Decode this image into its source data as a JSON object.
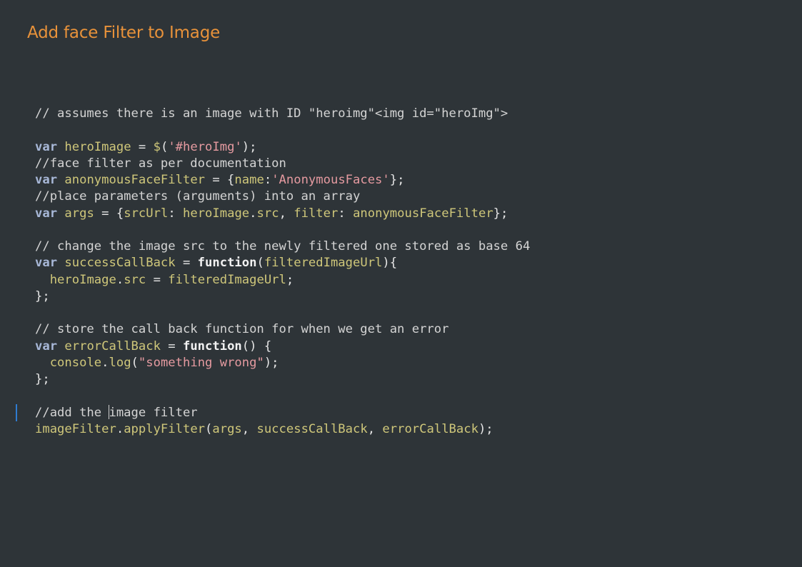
{
  "page": {
    "title": "Add face Filter to Image"
  },
  "theme": {
    "background": "#2e3438",
    "title_color": "#e8923a",
    "keyword_color": "#a8b8d8",
    "identifier_color": "#cfc77a",
    "string_color": "#e59aa0",
    "active_line_marker": "#2f7bd0"
  },
  "editor": {
    "cursor_line": 19,
    "lines": [
      [
        {
          "t": "comment",
          "v": "// assumes there is an image with ID \"heroimg\"<img id=\"heroImg\">"
        }
      ],
      [],
      [
        {
          "t": "keyword",
          "v": "var"
        },
        {
          "t": "plain",
          "v": " "
        },
        {
          "t": "ident",
          "v": "heroImage"
        },
        {
          "t": "plain",
          "v": " = "
        },
        {
          "t": "ident",
          "v": "$"
        },
        {
          "t": "plain",
          "v": "("
        },
        {
          "t": "string",
          "v": "'#heroImg'"
        },
        {
          "t": "plain",
          "v": ");"
        }
      ],
      [
        {
          "t": "comment",
          "v": "//face filter as per documentation"
        }
      ],
      [
        {
          "t": "keyword",
          "v": "var"
        },
        {
          "t": "plain",
          "v": " "
        },
        {
          "t": "ident",
          "v": "anonymousFaceFilter"
        },
        {
          "t": "plain",
          "v": " = {"
        },
        {
          "t": "ident",
          "v": "name"
        },
        {
          "t": "plain",
          "v": ":"
        },
        {
          "t": "string",
          "v": "'AnonymousFaces'"
        },
        {
          "t": "plain",
          "v": "};"
        }
      ],
      [
        {
          "t": "comment",
          "v": "//place parameters (arguments) into an array"
        }
      ],
      [
        {
          "t": "keyword",
          "v": "var"
        },
        {
          "t": "plain",
          "v": " "
        },
        {
          "t": "ident",
          "v": "args"
        },
        {
          "t": "plain",
          "v": " = {"
        },
        {
          "t": "ident",
          "v": "srcUrl"
        },
        {
          "t": "plain",
          "v": ": "
        },
        {
          "t": "ident",
          "v": "heroImage"
        },
        {
          "t": "plain",
          "v": "."
        },
        {
          "t": "ident",
          "v": "src"
        },
        {
          "t": "plain",
          "v": ", "
        },
        {
          "t": "ident",
          "v": "filter"
        },
        {
          "t": "plain",
          "v": ": "
        },
        {
          "t": "ident",
          "v": "anonymousFaceFilter"
        },
        {
          "t": "plain",
          "v": "};"
        }
      ],
      [],
      [
        {
          "t": "comment",
          "v": "// change the image src to the newly filtered one stored as base 64"
        }
      ],
      [
        {
          "t": "keyword",
          "v": "var"
        },
        {
          "t": "plain",
          "v": " "
        },
        {
          "t": "ident",
          "v": "successCallBack"
        },
        {
          "t": "plain",
          "v": " = "
        },
        {
          "t": "fn",
          "v": "function"
        },
        {
          "t": "plain",
          "v": "("
        },
        {
          "t": "ident",
          "v": "filteredImageUrl"
        },
        {
          "t": "plain",
          "v": "){"
        }
      ],
      [
        {
          "t": "plain",
          "v": "  "
        },
        {
          "t": "ident",
          "v": "heroImage"
        },
        {
          "t": "plain",
          "v": "."
        },
        {
          "t": "ident",
          "v": "src"
        },
        {
          "t": "plain",
          "v": " = "
        },
        {
          "t": "ident",
          "v": "filteredImageUrl"
        },
        {
          "t": "plain",
          "v": ";"
        }
      ],
      [
        {
          "t": "plain",
          "v": "};"
        }
      ],
      [],
      [
        {
          "t": "comment",
          "v": "// store the call back function for when we get an error"
        }
      ],
      [
        {
          "t": "keyword",
          "v": "var"
        },
        {
          "t": "plain",
          "v": " "
        },
        {
          "t": "ident",
          "v": "errorCallBack"
        },
        {
          "t": "plain",
          "v": " = "
        },
        {
          "t": "fn",
          "v": "function"
        },
        {
          "t": "plain",
          "v": "() {"
        }
      ],
      [
        {
          "t": "plain",
          "v": "  "
        },
        {
          "t": "ident",
          "v": "console"
        },
        {
          "t": "plain",
          "v": "."
        },
        {
          "t": "ident",
          "v": "log"
        },
        {
          "t": "plain",
          "v": "("
        },
        {
          "t": "string",
          "v": "\"something wrong\""
        },
        {
          "t": "plain",
          "v": ");"
        }
      ],
      [
        {
          "t": "plain",
          "v": "};"
        }
      ],
      [],
      [
        {
          "t": "comment",
          "v": "//add the "
        },
        {
          "t": "cursor",
          "v": ""
        },
        {
          "t": "comment",
          "v": "image filter"
        }
      ],
      [
        {
          "t": "ident",
          "v": "imageFilter"
        },
        {
          "t": "plain",
          "v": "."
        },
        {
          "t": "ident",
          "v": "applyFilter"
        },
        {
          "t": "plain",
          "v": "("
        },
        {
          "t": "ident",
          "v": "args"
        },
        {
          "t": "plain",
          "v": ", "
        },
        {
          "t": "ident",
          "v": "successCallBack"
        },
        {
          "t": "plain",
          "v": ", "
        },
        {
          "t": "ident",
          "v": "errorCallBack"
        },
        {
          "t": "plain",
          "v": ");"
        }
      ]
    ]
  }
}
